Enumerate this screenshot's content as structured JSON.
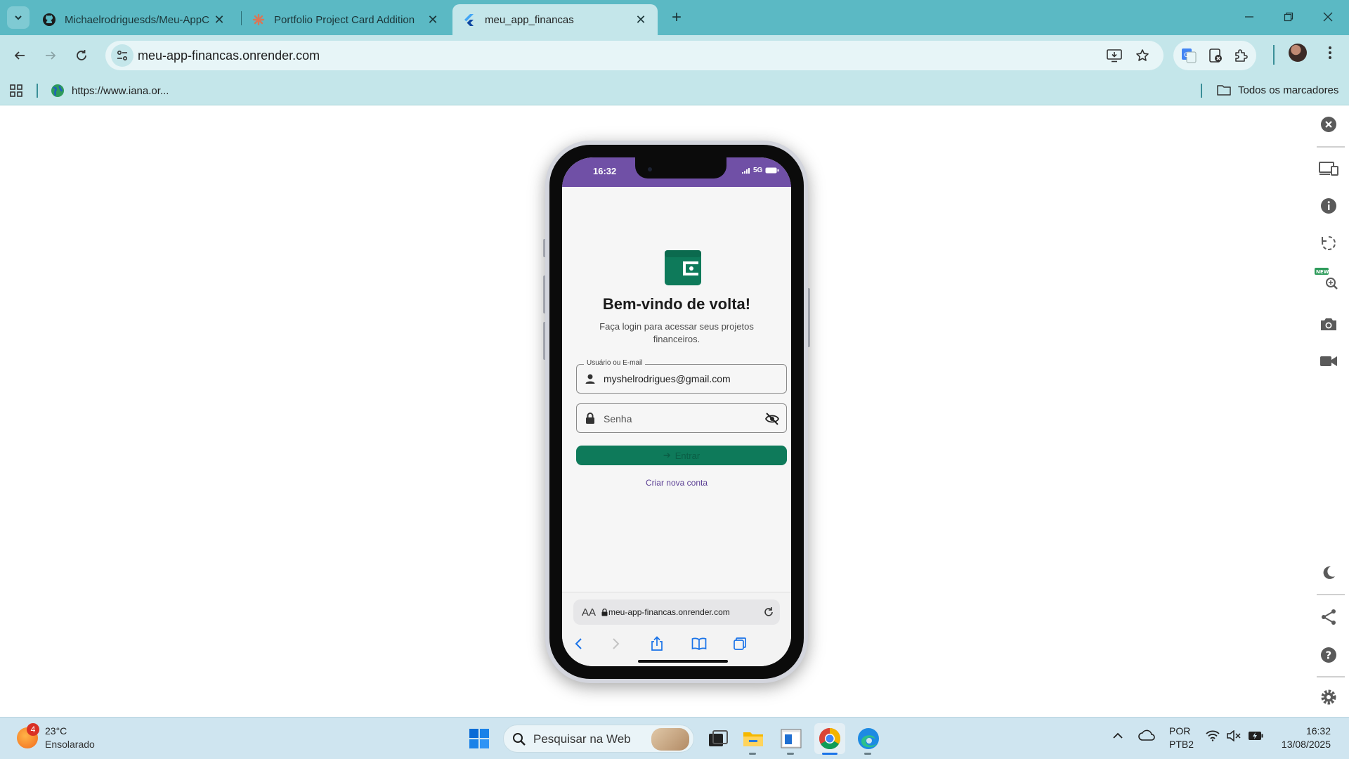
{
  "browser": {
    "tabs": [
      {
        "title": "Michaelrodriguesds/Meu-AppC",
        "favicon": "github-icon",
        "active": false
      },
      {
        "title": "Portfolio Project Card Addition",
        "favicon": "claude-icon",
        "active": false
      },
      {
        "title": "meu_app_financas",
        "favicon": "flutter-icon",
        "active": true
      }
    ],
    "address": "meu-app-financas.onrender.com",
    "bookmarks": [
      {
        "label": "https://www.iana.or..."
      }
    ],
    "all_bookmarks_label": "Todos os marcadores"
  },
  "phone": {
    "status_time": "16:32",
    "status_network": "5G",
    "app": {
      "title": "Bem-vindo de volta!",
      "subtitle": "Faça login para acessar seus projetos financeiros.",
      "user_field": {
        "label": "Usuário ou E-mail",
        "value": "myshelrodrigues@gmail.com"
      },
      "password_field": {
        "placeholder": "Senha"
      },
      "enter_button": "Entrar",
      "create_account_link": "Criar nova conta"
    },
    "safari": {
      "aa_label": "AA",
      "url": "meu-app-financas.onrender.com"
    }
  },
  "colors": {
    "chrome_frame": "#5bb9c4",
    "toolbar": "#c4e6ea",
    "app_status_bar": "#7050a6",
    "app_primary": "#0e7a5a",
    "link": "#5b3f94"
  },
  "taskbar": {
    "weather_temp": "23°C",
    "weather_desc": "Ensolarado",
    "weather_badge": "4",
    "search_placeholder": "Pesquisar na Web",
    "lang_top": "POR",
    "lang_bottom": "PTB2",
    "time": "16:32",
    "date": "13/08/2025"
  }
}
